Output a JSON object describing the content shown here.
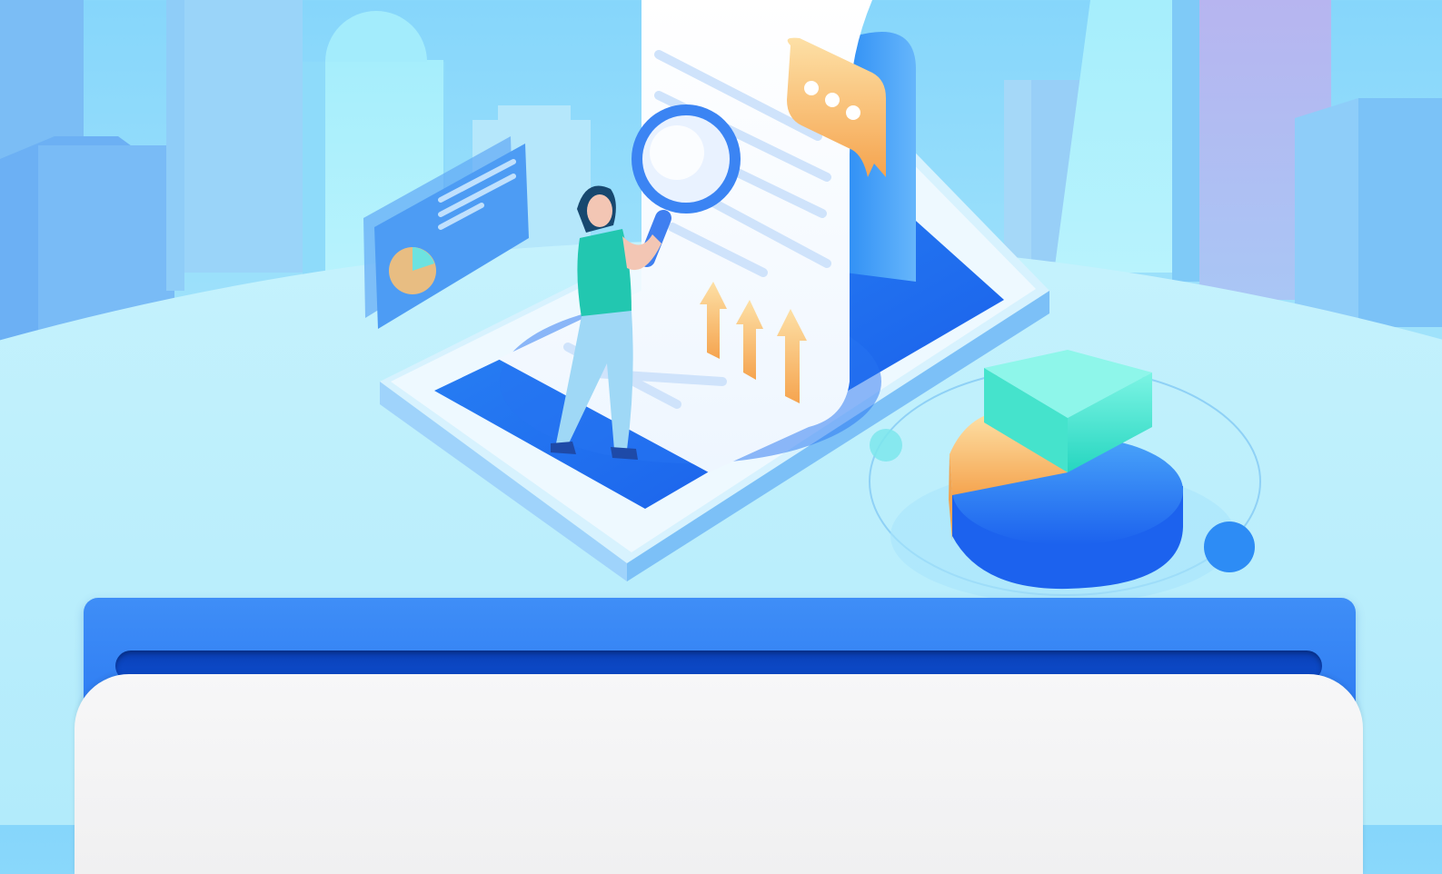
{
  "banner": {
    "illustration": "mobile-data-analysis-illustration",
    "colors": {
      "sky": "#86d6fb",
      "ground": "#b6effc",
      "phone_blue": "#1f6ff2",
      "accent_orange": "#f6b25a",
      "accent_teal": "#3ee3cf"
    }
  },
  "card": {
    "frame_color": "#1f6ff2",
    "sheet_color": "#f4f4f5"
  }
}
